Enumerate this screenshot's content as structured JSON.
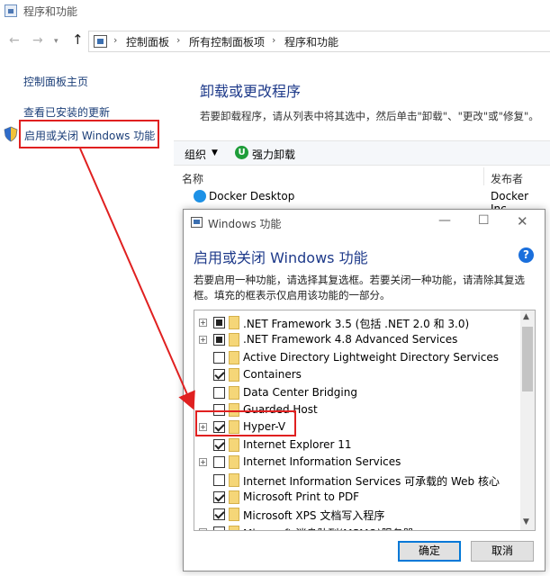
{
  "window": {
    "title": "程序和功能"
  },
  "nav": {
    "back_icon": "back-arrow-icon",
    "forward_icon": "forward-arrow-icon",
    "up_icon": "up-arrow-icon",
    "breadcrumbs": [
      "控制面板",
      "所有控制面板项",
      "程序和功能"
    ]
  },
  "left_pane": {
    "home": "控制面板主页",
    "updates": "查看已安装的更新",
    "features": "启用或关闭 Windows 功能"
  },
  "main": {
    "title": "卸载或更改程序",
    "description": "若要卸载程序，请从列表中将其选中，然后单击\"卸载\"、\"更改\"或\"修复\"。",
    "toolbar": {
      "organize": "组织",
      "uninstall": "强力卸载"
    },
    "columns": {
      "name": "名称",
      "publisher": "发布者"
    },
    "programs": [
      {
        "name": "Docker Desktop",
        "publisher": "Docker Inc."
      }
    ]
  },
  "dialog": {
    "title": "Windows 功能",
    "heading": "启用或关闭 Windows 功能",
    "help": "?",
    "description": "若要启用一种功能，请选择其复选框。若要关闭一种功能，请清除其复选框。填充的框表示仅启用该功能的一部分。",
    "features": [
      {
        "label": ".NET Framework 3.5 (包括 .NET 2.0 和 3.0)",
        "state": "partial",
        "expandable": true
      },
      {
        "label": ".NET Framework 4.8 Advanced Services",
        "state": "partial",
        "expandable": true
      },
      {
        "label": "Active Directory Lightweight Directory Services",
        "state": "unchecked",
        "expandable": false
      },
      {
        "label": "Containers",
        "state": "checked",
        "expandable": false
      },
      {
        "label": "Data Center Bridging",
        "state": "unchecked",
        "expandable": false
      },
      {
        "label": "Guarded Host",
        "state": "unchecked",
        "expandable": false
      },
      {
        "label": "Hyper-V",
        "state": "checked",
        "expandable": true
      },
      {
        "label": "Internet Explorer 11",
        "state": "checked",
        "expandable": false
      },
      {
        "label": "Internet Information Services",
        "state": "unchecked",
        "expandable": true
      },
      {
        "label": "Internet Information Services 可承载的 Web 核心",
        "state": "unchecked",
        "expandable": false
      },
      {
        "label": "Microsoft Print to PDF",
        "state": "checked",
        "expandable": false
      },
      {
        "label": "Microsoft XPS 文档写入程序",
        "state": "checked",
        "expandable": false
      },
      {
        "label": "Microsoft 消息队列(MSMQ)服务器",
        "state": "unchecked",
        "expandable": true
      }
    ],
    "ok": "确定",
    "cancel": "取消"
  },
  "colors": {
    "link": "#1b3e78",
    "heading": "#1e3a8a",
    "highlight": "#e02020",
    "accent": "#0078d7"
  }
}
